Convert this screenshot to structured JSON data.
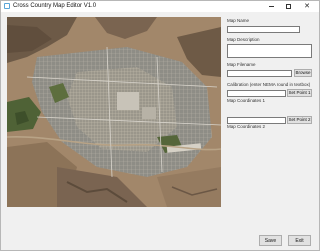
{
  "window": {
    "title": "Cross Country Map Editor V1.0",
    "controls": {
      "minimize": "",
      "maximize": "",
      "close": "✕"
    }
  },
  "form": {
    "map_name": {
      "label": "Map Name",
      "value": ""
    },
    "map_description": {
      "label": "Map Description",
      "value": ""
    },
    "map_filename": {
      "label": "Map Filename",
      "value": "",
      "browse_label": "Browse"
    },
    "calibration": {
      "label": "Calibration (enter NEMA round in textbox)"
    },
    "point1": {
      "value": "",
      "button_label": "Set Point 1",
      "coords_label": "Map Coordinates 1"
    },
    "point2": {
      "value": "",
      "button_label": "Set Point 2",
      "coords_label": "Map Coordinates 2"
    }
  },
  "footer": {
    "save_label": "Save",
    "exit_label": "Exit"
  },
  "colors": {
    "desert": "#a2876a",
    "city": "#8c8f8a",
    "vegetation": "#5a6a3c",
    "window_bg": "#f0f0f0"
  }
}
